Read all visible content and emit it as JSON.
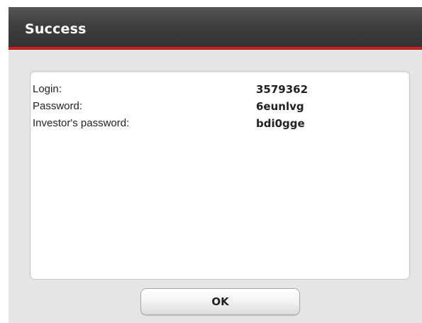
{
  "dialog": {
    "title": "Success",
    "accent_color": "#d11c1c",
    "title_bar_color": "#3f3f3f"
  },
  "credentials": [
    {
      "label": "Login:",
      "value": "3579362"
    },
    {
      "label": "Password:",
      "value": "6eunlvg"
    },
    {
      "label": "Investor's password:",
      "value": "bdi0gge"
    }
  ],
  "buttons": {
    "ok_label": "OK"
  }
}
